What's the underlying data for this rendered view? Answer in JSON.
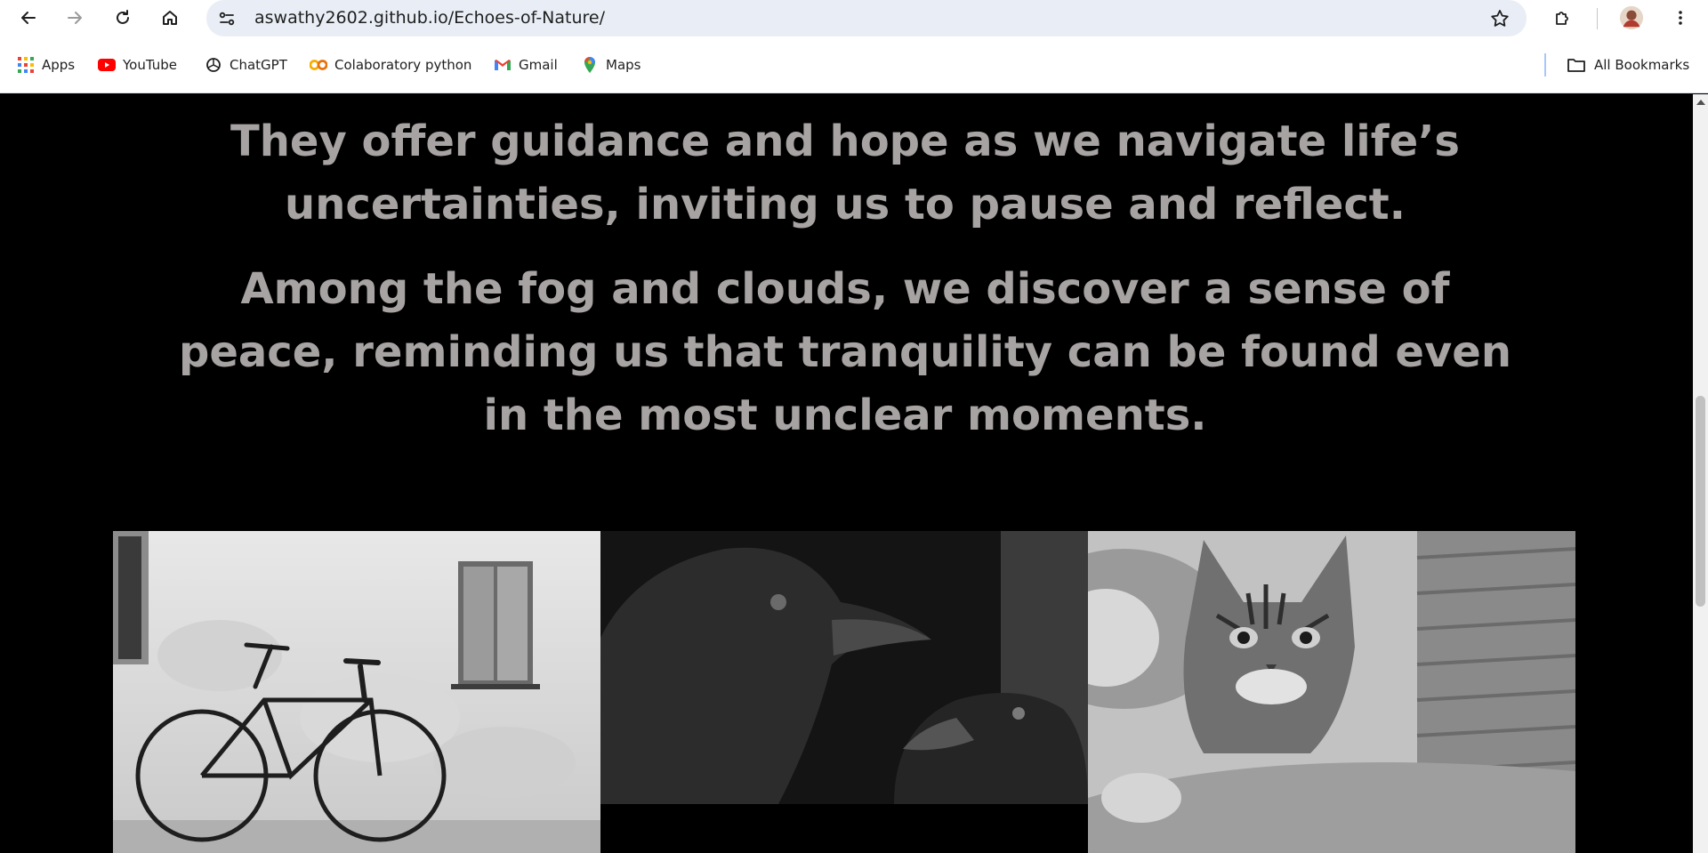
{
  "browser": {
    "url": "aswathy2602.github.io/Echoes-of-Nature/",
    "nav_buttons": [
      "back-icon",
      "forward-icon",
      "reload-icon",
      "home-icon"
    ],
    "right_icons": [
      "bookmark-star-icon",
      "extensions-icon",
      "profile-avatar",
      "menu-icon"
    ]
  },
  "bookmarks": {
    "items": [
      {
        "label": "Apps",
        "icon": "apps-grid-icon"
      },
      {
        "label": "YouTube",
        "icon": "youtube-icon"
      },
      {
        "label": "ChatGPT",
        "icon": "chatgpt-icon"
      },
      {
        "label": "Colaboratory python",
        "icon": "colab-icon"
      },
      {
        "label": "Gmail",
        "icon": "gmail-icon"
      },
      {
        "label": "Maps",
        "icon": "maps-icon"
      }
    ],
    "all_bookmarks": "All Bookmarks"
  },
  "page": {
    "paragraphs": [
      "They offer guidance and hope as we navigate life’s uncertainties, inviting us to pause and reflect.",
      "Among the fog and clouds, we discover a sense of peace, reminding us that tranquility can be found even in the most unclear moments."
    ],
    "gallery": [
      "bicycle-photo",
      "ravens-photo",
      "cat-photo"
    ],
    "text_color": "#a7a3a3",
    "background_color": "#000000"
  }
}
